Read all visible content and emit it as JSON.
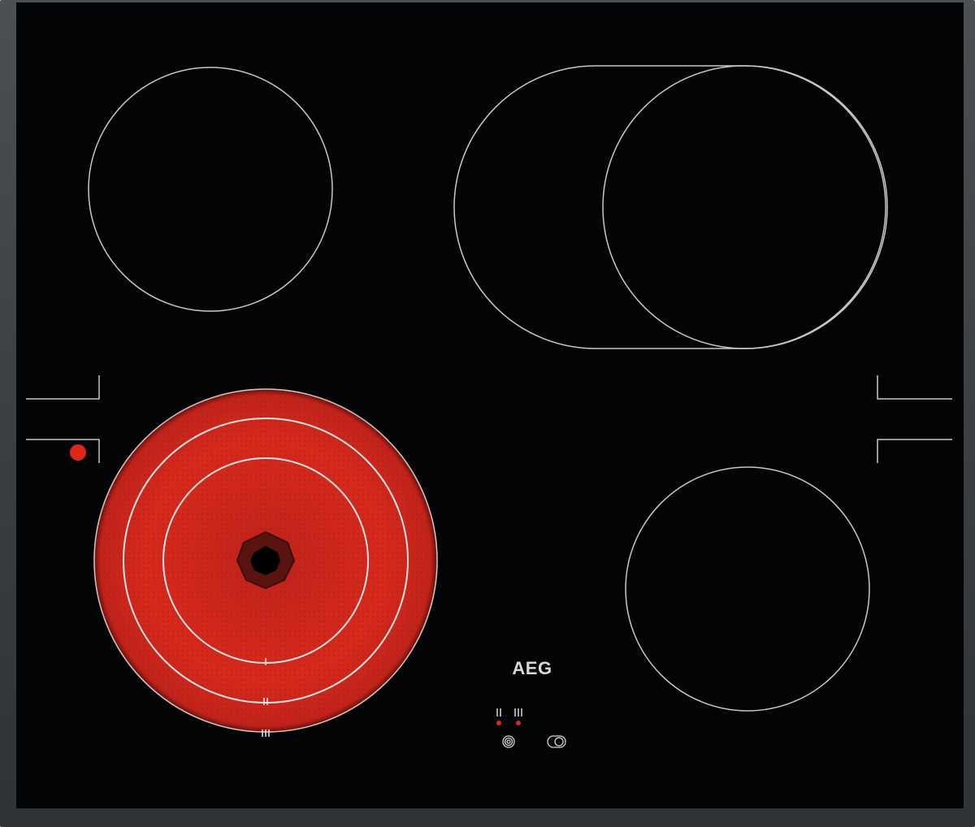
{
  "brand": {
    "logo_text": "AEG"
  },
  "zones": [
    {
      "id": "front-left",
      "state": "on"
    },
    {
      "id": "rear-left",
      "state": "off"
    },
    {
      "id": "rear-right-extended",
      "state": "off"
    },
    {
      "id": "front-right",
      "state": "off"
    }
  ],
  "indicators": {
    "residual_heat_light": "on",
    "zone_markers": [
      "I",
      "II",
      "III"
    ],
    "extension_marks": [
      "II",
      "III"
    ]
  },
  "icons": {
    "multi_ring_symbol": "triple-ring-icon",
    "oval_extension_symbol": "oval-zone-icon"
  },
  "colors": {
    "glass": "#030405",
    "frame": "#3a4044",
    "outline": "#c8c8c8",
    "heat_red": "#d8291c",
    "indicator_red": "#e0261b"
  }
}
